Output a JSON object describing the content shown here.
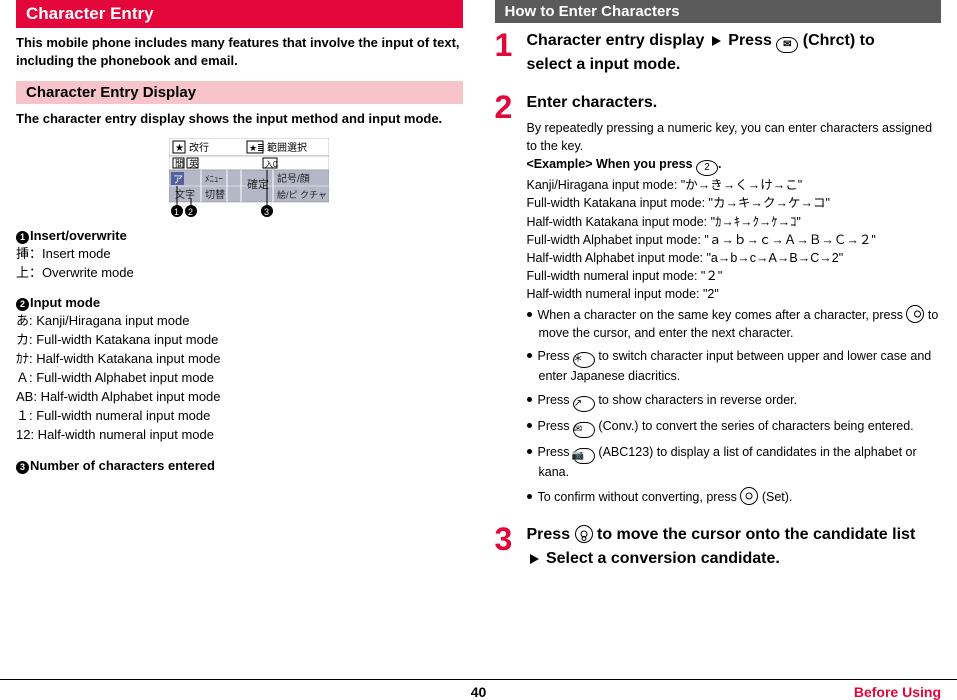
{
  "left": {
    "title": "Character Entry",
    "intro": "This mobile phone includes many features that involve the input of text, including the phonebook and email.",
    "subTitle": "Character Entry Display",
    "subIntro": "The character entry display shows the input method and input mode.",
    "diagram": {
      "topLeft": "改行",
      "topRight": "範囲選択",
      "rowLabels": [
        "間",
        "英"
      ],
      "smallBox": "0",
      "cells": [
        "文字",
        "切替",
        "",
        "確定",
        "記号/顔",
        "絵/ピクチャ"
      ],
      "menuLabel": "ﾒﾆｭｰ",
      "markerA": "ア",
      "markers": [
        "1",
        "2",
        "3"
      ]
    },
    "block1Head": "Insert/overwrite",
    "block1Lines": [
      "挿：Insert mode",
      "上：Overwrite mode"
    ],
    "block2Head": "Input mode",
    "block2Lines": [
      "あ: Kanji/Hiragana input mode",
      "カ: Full-width Katakana input mode",
      "ｶﾅ: Half-width Katakana input mode",
      "Ａ: Full-width Alphabet input mode",
      "AB: Half-width Alphabet input mode",
      "１: Full-width numeral input mode",
      "12: Half-width numeral input mode"
    ],
    "block3Head": "Number of characters entered"
  },
  "right": {
    "title": "How to Enter Characters",
    "steps": {
      "s1": {
        "num": "1",
        "beforeKey": "Character entry display",
        "afterKey1": "Press",
        "key": "✉",
        "keyLabel": "(Chrct) to",
        "line2": "select a input mode."
      },
      "s2": {
        "num": "2",
        "heading": "Enter characters.",
        "intro": "By repeatedly pressing a numeric key, you can enter characters assigned to the key.",
        "exampleHead": "<Example> When you press",
        "key": "2",
        "period": ".",
        "modes": [
          "Kanji/Hiragana input mode: \"か→き→く→け→こ\"",
          "Full-width Katakana input mode: \"カ→キ→ク→ケ→コ\"",
          "Half-width Katakana input mode: \"ｶ→ｷ→ｸ→ｹ→ｺ\"",
          "Full-width Alphabet input mode: \"ａ→ｂ→ｃ→Ａ→Ｂ→Ｃ→２\"",
          "Half-width Alphabet input mode: \"a→b→c→A→B→C→2\"",
          "Full-width numeral input mode: \"２\"",
          "Half-width numeral input mode: \"2\""
        ],
        "bullets": {
          "b1a": "When a character on the same key comes after a character, press",
          "b1b": "to move the cursor, and enter the next character.",
          "b2a": "Press",
          "b2key": "＊",
          "b2b": "to switch character input between upper and lower case and enter Japanese diacritics.",
          "b3a": "Press",
          "b3key": "↗",
          "b3b": "to show characters in reverse order.",
          "b4a": "Press",
          "b4key": "✉",
          "b4label": "(Conv.) to convert the series of characters being entered.",
          "b5a": "Press",
          "b5key": "📷",
          "b5label": "(ABC123) to display a list of candidates in the alphabet or kana.",
          "b6a": "To confirm without converting, press",
          "b6label": "(Set)."
        }
      },
      "s3": {
        "num": "3",
        "line1a": "Press",
        "line1b": "to move the cursor onto the candidate list",
        "line2": "Select a conversion candidate."
      }
    }
  },
  "footer": {
    "page": "40",
    "section": "Before Using"
  }
}
